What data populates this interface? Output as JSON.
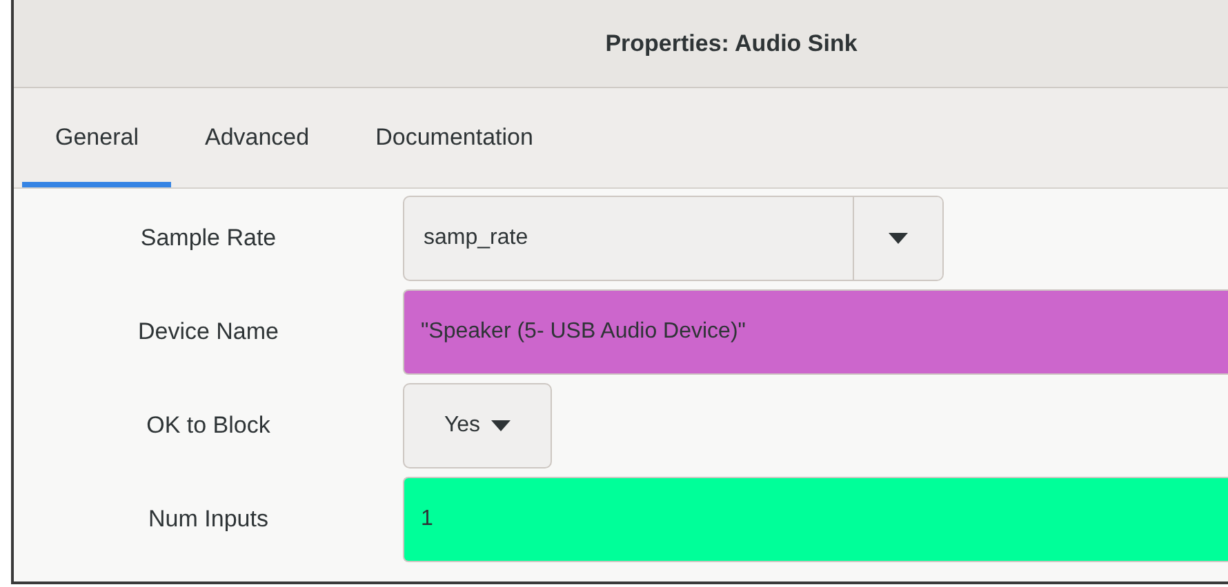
{
  "window": {
    "title": "Properties: Audio Sink"
  },
  "tabs": [
    {
      "label": "General",
      "selected": true
    },
    {
      "label": "Advanced",
      "selected": false
    },
    {
      "label": "Documentation",
      "selected": false
    }
  ],
  "params": [
    {
      "label": "Sample Rate",
      "kind": "combo",
      "value": "samp_rate"
    },
    {
      "label": "Device Name",
      "kind": "entry",
      "value": "\"Speaker (5- USB Audio Device)\"",
      "color": "#cc66cc"
    },
    {
      "label": "OK to Block",
      "kind": "dropdown",
      "value": "Yes"
    },
    {
      "label": "Num Inputs",
      "kind": "entry",
      "value": "1",
      "color": "#00ff99"
    }
  ]
}
